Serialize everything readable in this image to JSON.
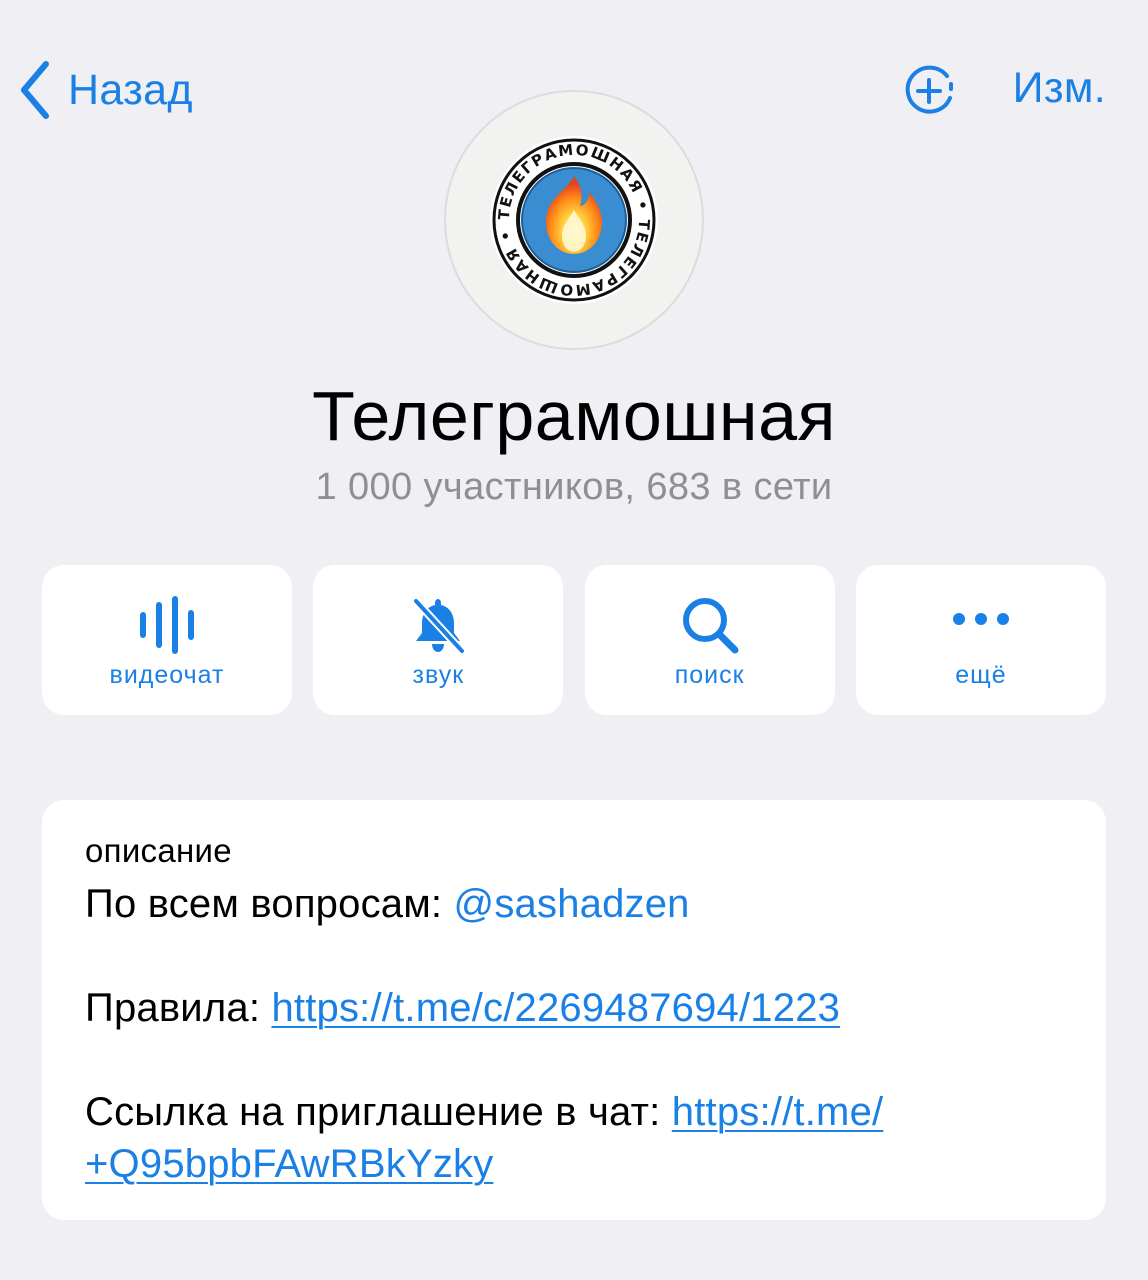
{
  "nav": {
    "back_label": "Назад",
    "edit_label": "Изм."
  },
  "avatar": {
    "ring_text": "ТЕЛЕГРАМОШНАЯ • ТЕЛЕГРАМОШНАЯ •",
    "center_icon": "fire-icon"
  },
  "channel": {
    "title": "Телеграмошная",
    "subtitle": "1 000 участников, 683 в сети"
  },
  "actions": [
    {
      "label": "видеочат",
      "icon": "video-chat-icon"
    },
    {
      "label": "звук",
      "icon": "bell-muted-icon"
    },
    {
      "label": "поиск",
      "icon": "search-icon"
    },
    {
      "label": "ещё",
      "icon": "more-icon"
    }
  ],
  "description": {
    "heading": "описание",
    "questions_label": "По всем вопросам: ",
    "questions_link": "@sashadzen",
    "rules_label": "Правила: ",
    "rules_link": "https://t.me/c/2269487694/1223",
    "invite_label": "Ссылка на приглашение в чат: ",
    "invite_link_part1": "https://t.me/",
    "invite_link_part2": "+Q95bpbFAwRBkYzky"
  },
  "colors": {
    "accent": "#1a80e5",
    "background": "#efeff4",
    "card": "#ffffff",
    "secondary_text": "#8e8e93"
  }
}
